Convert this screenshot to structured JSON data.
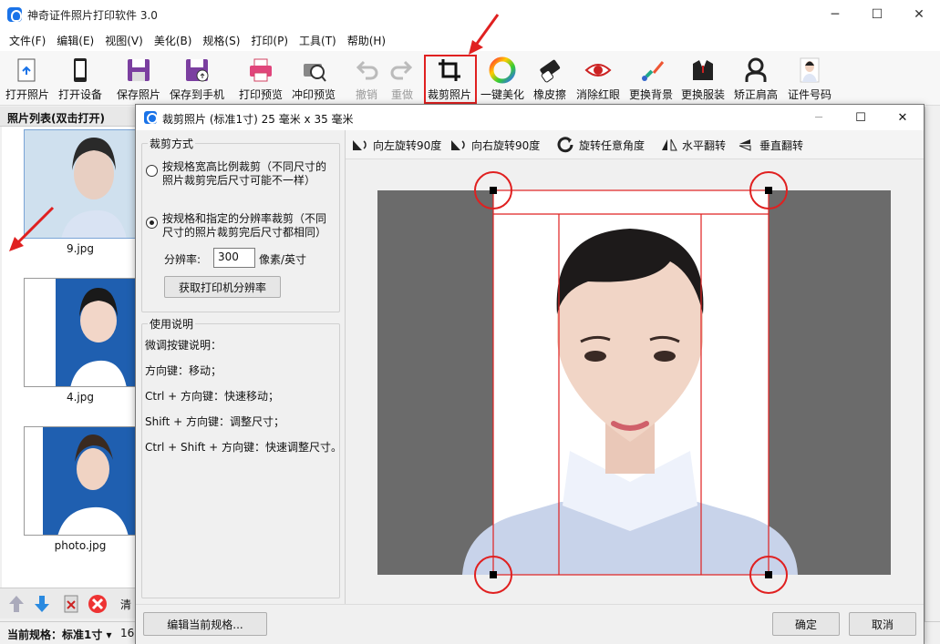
{
  "app": {
    "title": "神奇证件照片打印软件 3.0"
  },
  "menu": [
    "文件(F)",
    "编辑(E)",
    "视图(V)",
    "美化(B)",
    "规格(S)",
    "打印(P)",
    "工具(T)",
    "帮助(H)"
  ],
  "toolbar": {
    "open_photo": "打开照片",
    "open_device": "打开设备",
    "save_photo": "保存照片",
    "save_to_phone": "保存到手机",
    "print_preview": "打印预览",
    "develop_preview": "冲印预览",
    "undo": "撤销",
    "redo": "重做",
    "crop_photo": "裁剪照片",
    "one_click_beautify": "一键美化",
    "eraser": "橡皮擦",
    "remove_red_eye": "消除红眼",
    "change_background": "更换背景",
    "change_clothes": "更换服装",
    "correct_shoulders": "矫正肩高",
    "id_size": "证件号码"
  },
  "left_panel": {
    "header": "照片列表(双击打开)",
    "photos": [
      {
        "name": "9.jpg"
      },
      {
        "name": "4.jpg"
      },
      {
        "name": "photo.jpg"
      }
    ],
    "bottom_label": "清"
  },
  "status": {
    "current_spec_label": "当前规格：",
    "current_spec_value": "标准1寸",
    "extra": "16"
  },
  "dialog": {
    "title": "裁剪照片 (标准1寸) 25 毫米 x 35 毫米",
    "crop_mode_title": "裁剪方式",
    "option1": "按规格宽高比例裁剪（不同尺寸的照片裁剪完后尺寸可能不一样）",
    "option1_line1": "按规格宽高比例裁剪（不同尺寸的",
    "option1_line2": "照片裁剪完后尺寸可能不一样）",
    "option2_line1": "按规格和指定的分辨率裁剪（不同",
    "option2_line2": "尺寸的照片裁剪完后尺寸都相同）",
    "selected_option": 2,
    "resolution_label": "分辨率:",
    "resolution_value": "300",
    "resolution_unit": "像素/英寸",
    "get_printer_resolution": "获取打印机分辨率",
    "usage_title": "使用说明",
    "help": [
      "微调按键说明：",
      "方向键：移动；",
      "Ctrl + 方向键：快速移动；",
      "Shift + 方向键：调整尺寸；",
      "Ctrl + Shift + 方向键：快速调整尺寸。"
    ],
    "tools": {
      "rotate_left": "向左旋转90度",
      "rotate_right": "向右旋转90度",
      "rotate_any": "旋转任意角度",
      "flip_h": "水平翻转",
      "flip_v": "垂直翻转"
    },
    "edit_spec_button": "编辑当前规格...",
    "ok_button": "确定",
    "cancel_button": "取消"
  },
  "colors": {
    "accent": "#1a73e8",
    "crop_border": "#e02020",
    "id_photo_bg": "#1f5fb0"
  }
}
